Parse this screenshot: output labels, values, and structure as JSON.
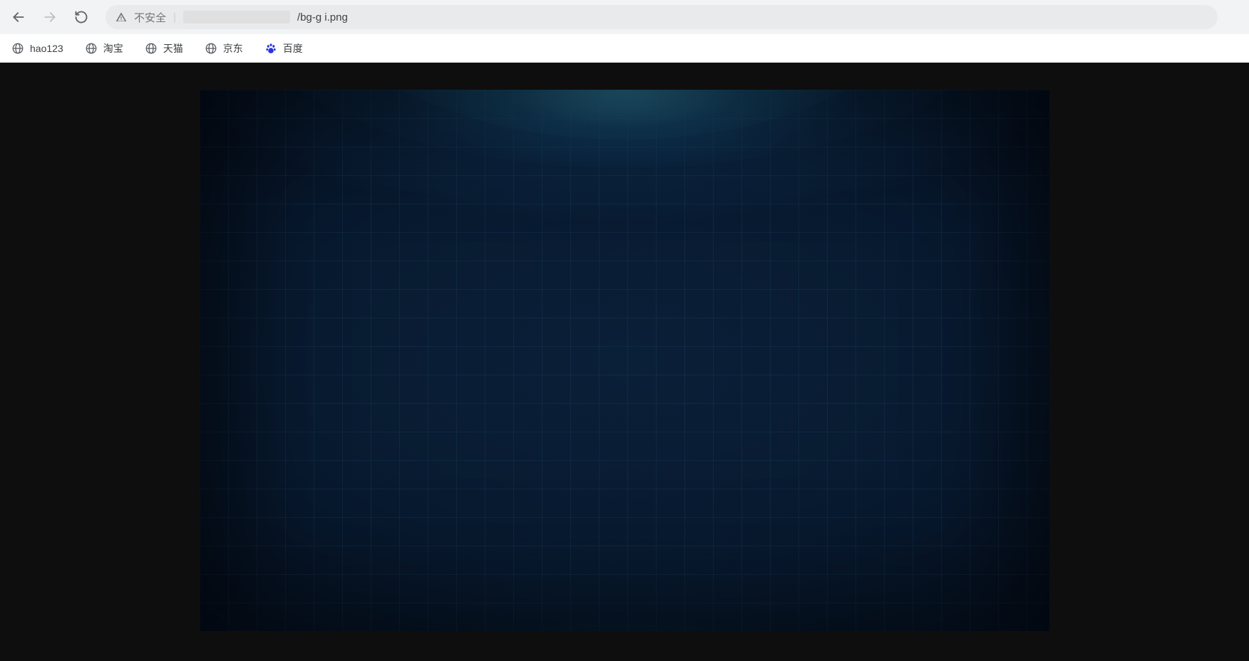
{
  "toolbar": {
    "insecure_label": "不安全",
    "url_path": "/bg-g   i.png"
  },
  "bookmarks": [
    {
      "label": "hao123",
      "icon": "globe"
    },
    {
      "label": "淘宝",
      "icon": "globe"
    },
    {
      "label": "天猫",
      "icon": "globe"
    },
    {
      "label": "京东",
      "icon": "globe"
    },
    {
      "label": "百度",
      "icon": "paw"
    }
  ]
}
